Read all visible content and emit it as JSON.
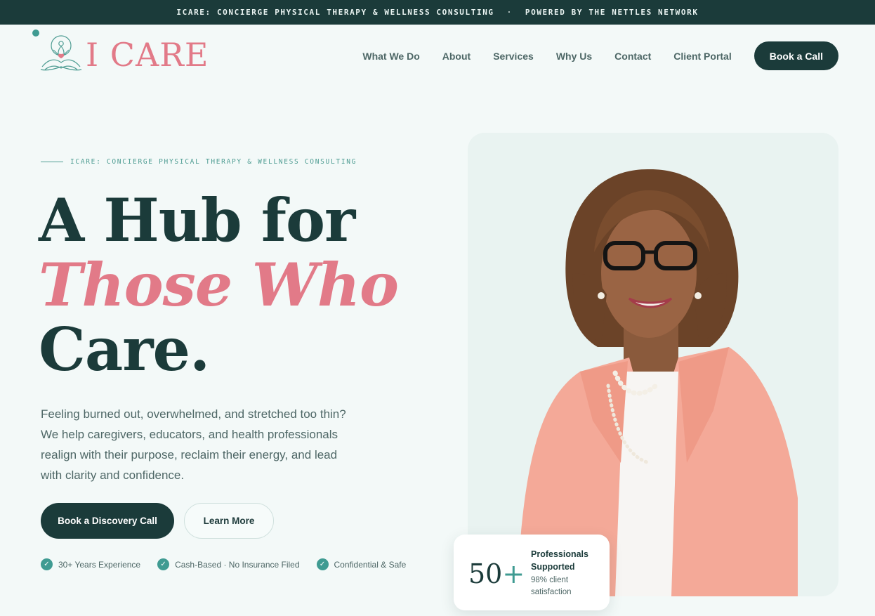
{
  "announcement": {
    "left": "ICARE: CONCIERGE PHYSICAL THERAPY & WELLNESS CONSULTING",
    "separator": "·",
    "right": "POWERED BY THE NETTLES NETWORK"
  },
  "brand": {
    "logo_text": "I CARE",
    "logo_icon": "meditating-figure-heart-icon",
    "colors": {
      "primary": "#1b3b3a",
      "accent_pink": "#e27a88",
      "accent_teal": "#3f9b92",
      "background": "#f3f9f8"
    }
  },
  "nav": {
    "items": [
      {
        "label": "What We Do"
      },
      {
        "label": "About"
      },
      {
        "label": "Services"
      },
      {
        "label": "Why Us"
      },
      {
        "label": "Contact"
      },
      {
        "label": "Client Portal"
      }
    ],
    "cta": "Book a Call"
  },
  "hero": {
    "eyebrow": "ICARE: CONCIERGE PHYSICAL THERAPY & WELLNESS CONSULTING",
    "headline_line1": "A Hub for",
    "headline_accent": "Those Who",
    "headline_line3": "Care.",
    "description": "Feeling burned out, overwhelmed, and stretched too thin? We help caregivers, educators, and health professionals realign with their purpose, reclaim their energy, and lead with clarity and confidence.",
    "primary_button": "Book a Discovery Call",
    "secondary_button": "Learn More",
    "badges": [
      {
        "icon": "check-icon",
        "label": "30+ Years Experience"
      },
      {
        "icon": "check-icon",
        "label": "Cash-Based · No Insurance Filed"
      },
      {
        "icon": "check-icon",
        "label": "Confidential & Safe"
      }
    ]
  },
  "stat_card": {
    "number": "50",
    "suffix": "+",
    "title": "Professionals Supported",
    "subtitle": "98% client satisfaction"
  }
}
